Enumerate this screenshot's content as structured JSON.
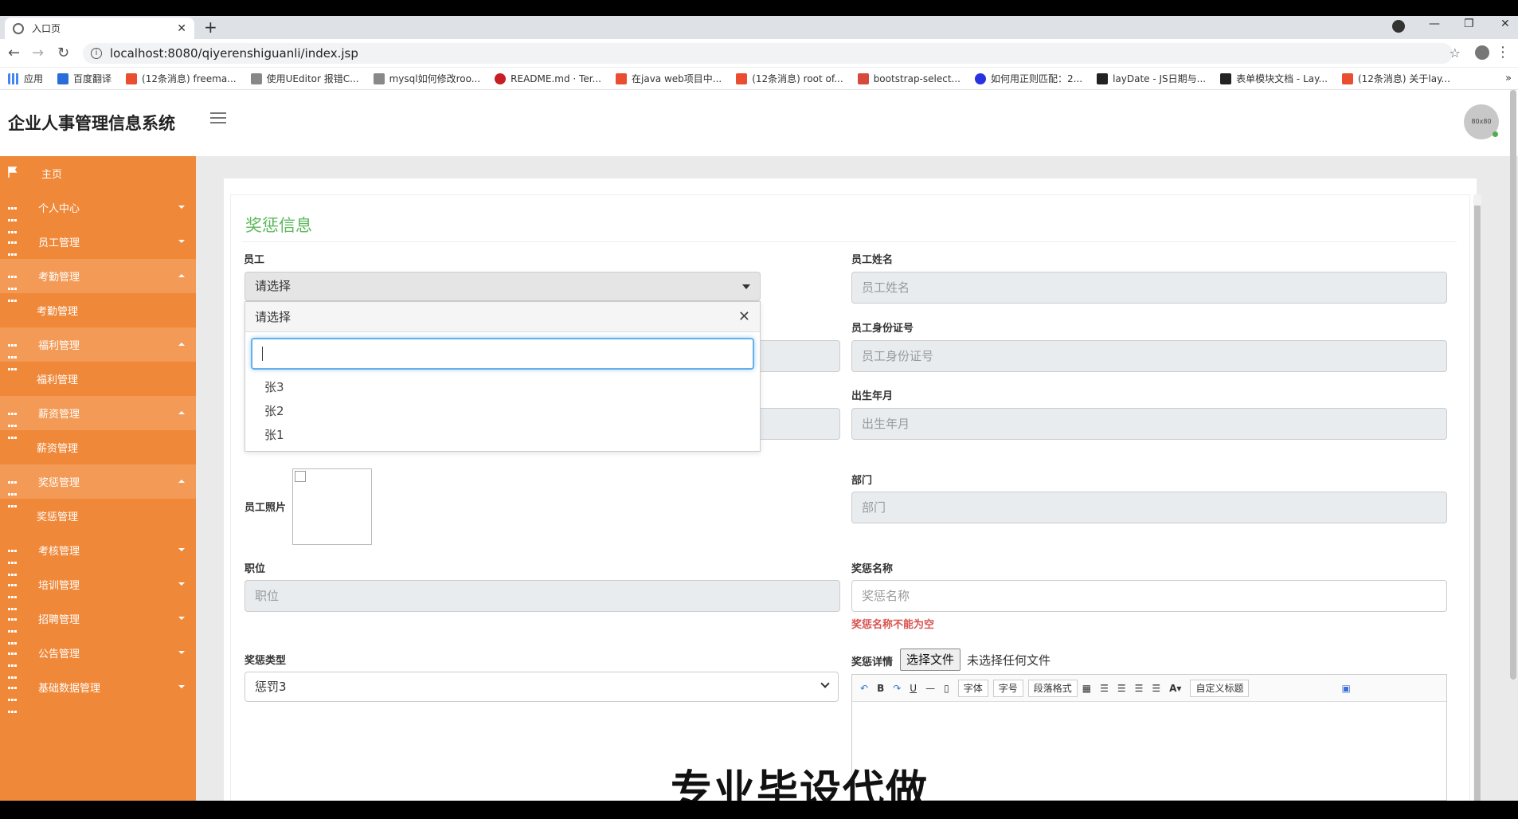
{
  "browser": {
    "tab_title": "入口页",
    "url": "localhost:8080/qiyerenshiguanli/index.jsp",
    "bookmarks": [
      "应用",
      "百度翻译",
      "(12条消息) freema...",
      "使用UEditor 报错C...",
      "mysql如何修改roo...",
      "README.md · Ter...",
      "在java web项目中...",
      "(12条消息) root of...",
      "bootstrap-select...",
      "如何用正则匹配：2...",
      "layDate - JS日期与...",
      "表单模块文档 - Lay...",
      "(12条消息) 关于lay..."
    ],
    "bookmark_more": "»"
  },
  "header": {
    "brand": "企业人事管理信息系统",
    "avatar_text": "80x80"
  },
  "sidebar": {
    "items": [
      {
        "label": "主页"
      },
      {
        "label": "个人中心"
      },
      {
        "label": "员工管理"
      },
      {
        "label": "考勤管理",
        "sub": "考勤管理"
      },
      {
        "label": "福利管理",
        "sub": "福利管理"
      },
      {
        "label": "薪资管理",
        "sub": "薪资管理"
      },
      {
        "label": "奖惩管理",
        "sub": "奖惩管理"
      },
      {
        "label": "考核管理"
      },
      {
        "label": "培训管理"
      },
      {
        "label": "招聘管理"
      },
      {
        "label": "公告管理"
      },
      {
        "label": "基础数据管理"
      }
    ]
  },
  "form": {
    "title": "奖惩信息",
    "employee": {
      "label": "员工",
      "value": "请选择"
    },
    "dropdown": {
      "header": "请选择",
      "options": [
        "张3",
        "张2",
        "张1"
      ]
    },
    "employee_name": {
      "label": "员工姓名",
      "placeholder": "员工姓名"
    },
    "employee_id": {
      "label": "员工身份证号",
      "placeholder": "员工身份证号"
    },
    "birth": {
      "label": "出生年月",
      "placeholder": "出生年月"
    },
    "photo_label": "员工照片",
    "department": {
      "label": "部门",
      "placeholder": "部门"
    },
    "position": {
      "label": "职位",
      "placeholder": "职位"
    },
    "reward_name": {
      "label": "奖惩名称",
      "placeholder": "奖惩名称",
      "error": "奖惩名称不能为空"
    },
    "reward_type": {
      "label": "奖惩类型",
      "value": "惩罚3"
    },
    "reward_detail": {
      "label": "奖惩详情",
      "file_button": "选择文件",
      "file_status": "未选择任何文件"
    },
    "editor_toolbar": {
      "font": "字体",
      "size": "字号",
      "paragraph": "段落格式",
      "custom": "自定义标题"
    }
  },
  "watermark": "专业毕设代做",
  "colors": {
    "sidebar": "#f08839",
    "title": "#5cb85c",
    "error": "#d9534f"
  }
}
